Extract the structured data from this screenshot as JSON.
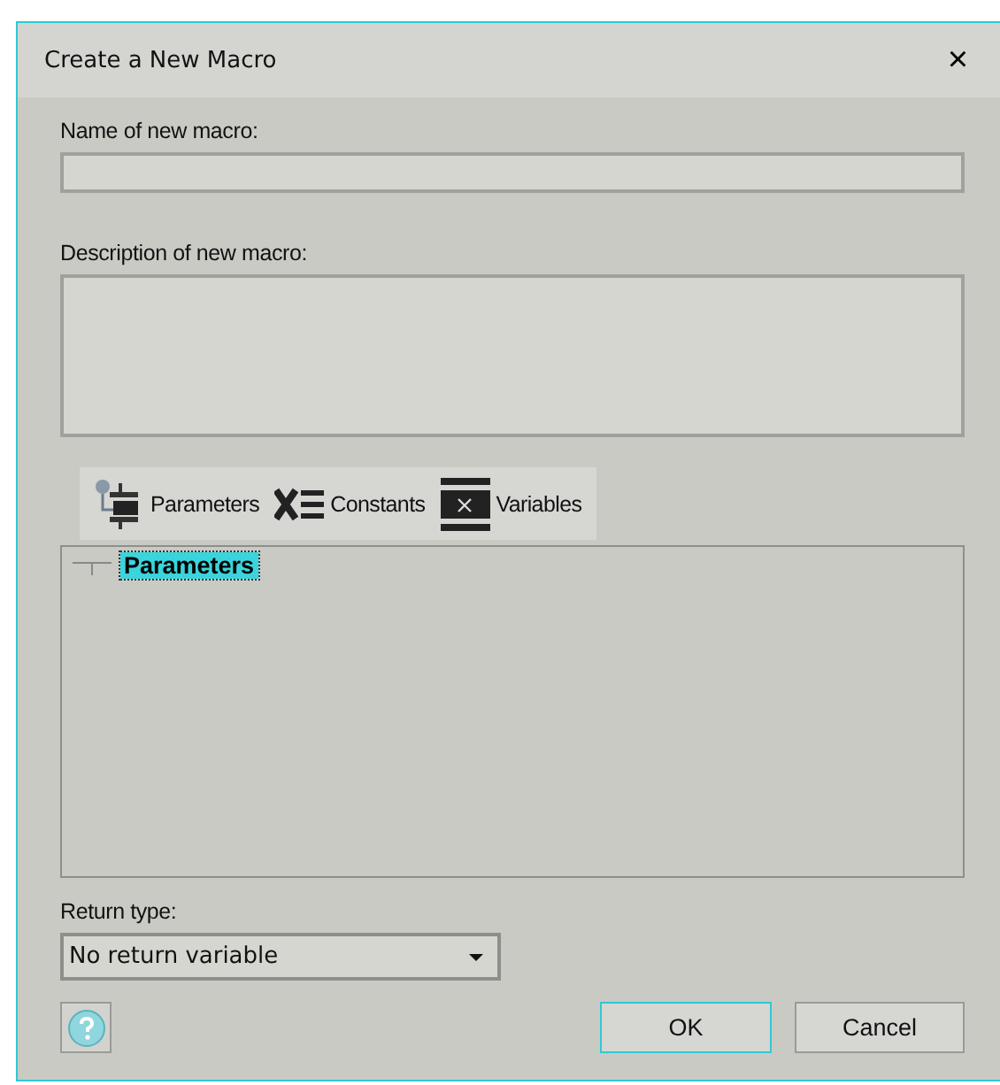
{
  "window": {
    "title": "Create a New Macro",
    "close": "×"
  },
  "name_field": {
    "label": "Name of new macro:"
  },
  "description_field": {
    "label": "Description of new macro:"
  },
  "tabs": [
    {
      "label": "Parameters",
      "kind": "parameters"
    },
    {
      "label": "Constants",
      "kind": "constants"
    },
    {
      "label": "Variables",
      "kind": "variables"
    }
  ],
  "tree": [
    {
      "label": "Parameters",
      "selected": true
    }
  ],
  "return_type": {
    "label": "Return type:",
    "value": "No return variable"
  },
  "buttons": [
    {
      "label": "OK",
      "default": true
    },
    {
      "label": "Cancel",
      "default": false
    }
  ]
}
